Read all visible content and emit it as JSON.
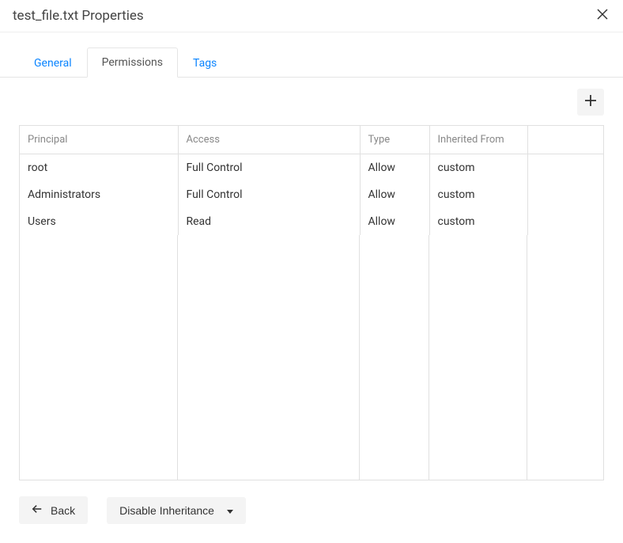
{
  "header": {
    "title": "test_file.txt Properties"
  },
  "tabs": [
    {
      "label": "General",
      "active": false
    },
    {
      "label": "Permissions",
      "active": true
    },
    {
      "label": "Tags",
      "active": false
    }
  ],
  "permissions_table": {
    "columns": {
      "principal": "Principal",
      "access": "Access",
      "type": "Type",
      "inherited": "Inherited From",
      "actions": ""
    },
    "rows": [
      {
        "principal": "root",
        "access": "Full Control",
        "type": "Allow",
        "inherited": "custom"
      },
      {
        "principal": "Administrators",
        "access": "Full Control",
        "type": "Allow",
        "inherited": "custom"
      },
      {
        "principal": "Users",
        "access": "Read",
        "type": "Allow",
        "inherited": "custom"
      }
    ]
  },
  "footer": {
    "back_label": "Back",
    "disable_inheritance_label": "Disable Inheritance"
  }
}
